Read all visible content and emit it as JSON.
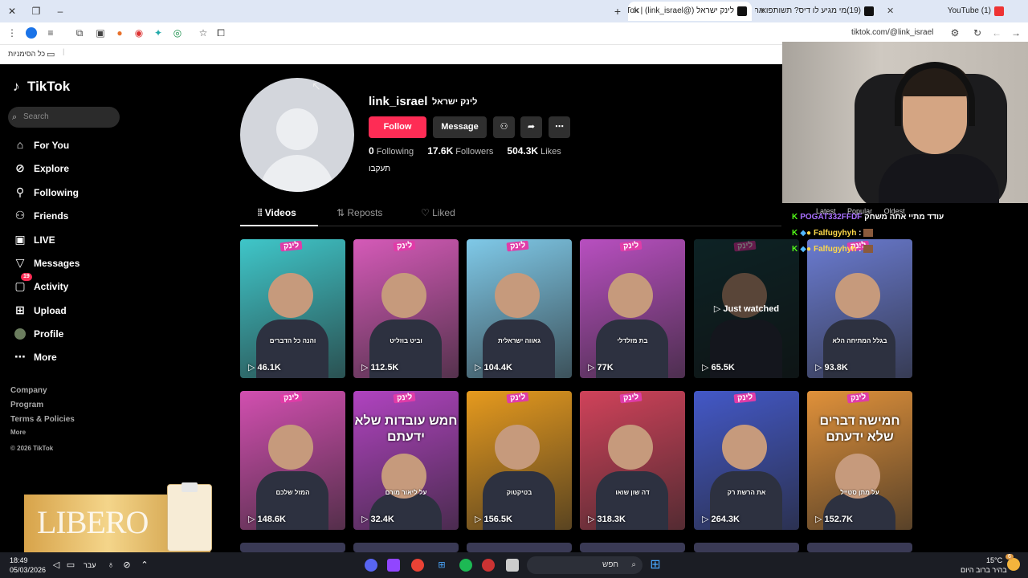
{
  "browser": {
    "tabs": [
      {
        "title": "(1) YouTube",
        "active": false
      },
      {
        "title": "(19)מי מגיע לו דיס? תשותפו את",
        "active": false
      },
      {
        "title": "לינק ישראל (@link_israel) | Tok",
        "active": true
      }
    ],
    "url": "tiktok.com/@link_israel",
    "bookmarks_label": "כל הסימניות"
  },
  "sidebar": {
    "logo": "TikTok",
    "search_placeholder": "Search",
    "items": [
      {
        "label": "For You",
        "icon": "home-icon"
      },
      {
        "label": "Explore",
        "icon": "compass-icon"
      },
      {
        "label": "Following",
        "icon": "following-icon"
      },
      {
        "label": "Friends",
        "icon": "friends-icon"
      },
      {
        "label": "LIVE",
        "icon": "live-icon"
      },
      {
        "label": "Messages",
        "icon": "messages-icon"
      },
      {
        "label": "Activity",
        "icon": "activity-icon",
        "badge": "19"
      },
      {
        "label": "Upload",
        "icon": "upload-icon"
      },
      {
        "label": "Profile",
        "icon": "profile-icon"
      },
      {
        "label": "More",
        "icon": "more-icon"
      }
    ],
    "footer": {
      "company": "Company",
      "program": "Program",
      "terms": "Terms & Policies",
      "more": "More",
      "copyright": "© 2026 TikTok"
    }
  },
  "profile": {
    "username": "link_israel",
    "nickname": "לינק ישראל",
    "follow": "Follow",
    "message": "Message",
    "following_count": "0",
    "following_label": "Following",
    "followers_count": "17.6K",
    "followers_label": "Followers",
    "likes_count": "504.3K",
    "likes_label": "Likes",
    "bio": "תעקבו"
  },
  "profile_tabs": {
    "videos": "Videos",
    "reposts": "Reposts",
    "liked": "Liked"
  },
  "videos": [
    {
      "views": "46.1K",
      "caption": "והנה כל הדברים",
      "bg": "#3fc6c9",
      "brand": "לינק"
    },
    {
      "views": "112.5K",
      "caption": "וביט בוזליט",
      "bg": "#d55ab8",
      "brand": "לינק"
    },
    {
      "views": "104.4K",
      "caption": "גאווה ישראלית",
      "bg": "#7fc9e8",
      "brand": "לינק"
    },
    {
      "views": "77K",
      "caption": "בת מזלדלי",
      "bg": "#b84fc0",
      "brand": "לינק"
    },
    {
      "views": "65.5K",
      "caption": "",
      "bg": "#1d4d52",
      "brand": "לינק",
      "overlay": "Just watched"
    },
    {
      "views": "93.8K",
      "caption": "בגלל המתיחה הלא",
      "bg": "#6a7bd1",
      "brand": "לינק"
    },
    {
      "views": "148.6K",
      "caption": "המזל שלכם",
      "bg": "#d24fb0",
      "brand": "לינק"
    },
    {
      "views": "32.4K",
      "caption": "על ליאור מורם",
      "bg": "#b043c0",
      "brand": "לינק",
      "big": "חמש עובדות שלא ידעתם"
    },
    {
      "views": "156.5K",
      "caption": "בטיקטוק",
      "bg": "#e69a1e",
      "brand": "לינק"
    },
    {
      "views": "318.3K",
      "caption": "דה שון שואו",
      "bg": "#d0425a",
      "brand": "לינק"
    },
    {
      "views": "264.3K",
      "caption": "את הרשת רק",
      "bg": "#4358c7",
      "brand": "לינק"
    },
    {
      "views": "152.7K",
      "caption": "על מתן סטייל",
      "bg": "#e0913a",
      "brand": "לינק",
      "big": "חמישה דברים שלא ידעתם"
    }
  ],
  "chat": {
    "tabs": [
      "Latest",
      "Popular",
      "Oldest"
    ],
    "lines": [
      {
        "user": "POGAT332FFDF",
        "text": "עודד מתיי אתה משחק",
        "color": "#a970ff"
      },
      {
        "user": "Falfugyhyh",
        "text": ":",
        "color": "#ffd94a"
      },
      {
        "user": "Falfugyhyh",
        "text": ":",
        "color": "#ffd94a"
      }
    ]
  },
  "ad": {
    "text": "LIBERO"
  },
  "taskbar": {
    "time": "18:49",
    "date": "05/03/2026",
    "lang": "עבר",
    "search": "חפש",
    "weather_temp": "15°C",
    "weather_desc": "בהיר ברוב היום",
    "notif_count": "6"
  }
}
